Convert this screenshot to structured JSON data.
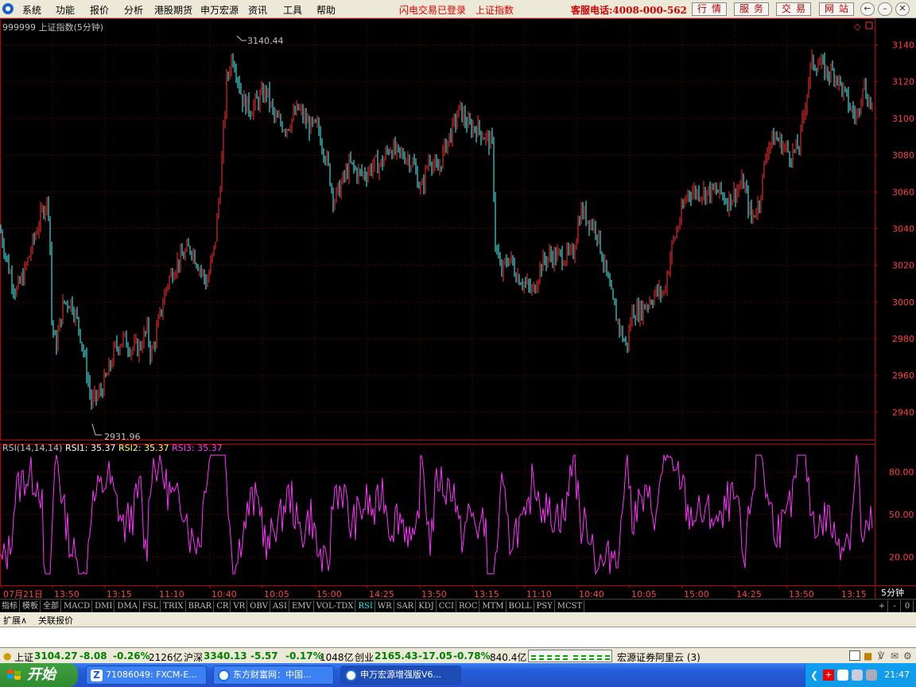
{
  "menu": {
    "items": [
      "系统",
      "功能",
      "报价",
      "分析",
      "港股期货",
      "申万宏源",
      "资讯",
      "工具",
      "帮助"
    ],
    "status_login": "闪电交易已登录",
    "index_name": "上证指数",
    "hotline": "客服电话:4008-000-562",
    "buttons": [
      "行情",
      "服务",
      "交易",
      "网站"
    ]
  },
  "chart": {
    "header": "999999 上证指数(5分钟)",
    "max_label": "3140.44",
    "min_label": "2931.96",
    "price_ticks": [
      "3140",
      "3120",
      "3100",
      "3080",
      "3060",
      "3040",
      "3020",
      "3000",
      "2980",
      "2960",
      "2940"
    ],
    "rsi_header": {
      "name": "RSI(14,14,14)",
      "rsi1": "RSI1: 35.37",
      "rsi2": "RSI2: 35.37",
      "rsi3": "RSI3: 35.37"
    },
    "rsi_ticks": [
      "80.00",
      "50.00",
      "20.00"
    ],
    "time_labels": [
      "07月21日",
      "13:50",
      "13:15",
      "11:10",
      "10:40",
      "10:05",
      "15:00",
      "14:25",
      "13:50",
      "13:15",
      "11:10",
      "10:40",
      "10:05",
      "15:00",
      "14:25",
      "13:50",
      "13:15"
    ],
    "period": "5分钟"
  },
  "chart_data": {
    "type": "candlestick",
    "title": "999999 上证指数(5分钟)",
    "ylim": [
      2925,
      3145
    ],
    "max": 3140.44,
    "min": 2931.96,
    "rsi": {
      "rsi1": 35.37,
      "rsi2": 35.37,
      "rsi3": 35.37,
      "ylim": [
        0,
        100
      ]
    },
    "close_path": [
      [
        0,
        3040
      ],
      [
        10,
        3020
      ],
      [
        20,
        3005
      ],
      [
        30,
        3015
      ],
      [
        40,
        3030
      ],
      [
        50,
        3045
      ],
      [
        58,
        3055
      ],
      [
        62,
        3050
      ],
      [
        65,
        2990
      ],
      [
        70,
        2975
      ],
      [
        80,
        3000
      ],
      [
        90,
        3000
      ],
      [
        100,
        2985
      ],
      [
        108,
        2965
      ],
      [
        115,
        2945
      ],
      [
        125,
        2950
      ],
      [
        135,
        2960
      ],
      [
        145,
        2975
      ],
      [
        155,
        2980
      ],
      [
        165,
        2975
      ],
      [
        175,
        2975
      ],
      [
        185,
        2985
      ],
      [
        190,
        2970
      ],
      [
        200,
        2990
      ],
      [
        210,
        3010
      ],
      [
        220,
        3020
      ],
      [
        230,
        3025
      ],
      [
        240,
        3030
      ],
      [
        250,
        3020
      ],
      [
        260,
        3010
      ],
      [
        270,
        3030
      ],
      [
        278,
        3070
      ],
      [
        285,
        3120
      ],
      [
        292,
        3135
      ],
      [
        298,
        3125
      ],
      [
        305,
        3110
      ],
      [
        315,
        3105
      ],
      [
        325,
        3110
      ],
      [
        335,
        3115
      ],
      [
        345,
        3100
      ],
      [
        360,
        3095
      ],
      [
        375,
        3105
      ],
      [
        390,
        3095
      ],
      [
        400,
        3095
      ],
      [
        412,
        3075
      ],
      [
        420,
        3055
      ],
      [
        430,
        3065
      ],
      [
        440,
        3075
      ],
      [
        450,
        3070
      ],
      [
        460,
        3070
      ],
      [
        470,
        3075
      ],
      [
        480,
        3075
      ],
      [
        490,
        3085
      ],
      [
        500,
        3080
      ],
      [
        510,
        3080
      ],
      [
        520,
        3075
      ],
      [
        530,
        3060
      ],
      [
        540,
        3080
      ],
      [
        550,
        3070
      ],
      [
        560,
        3085
      ],
      [
        570,
        3095
      ],
      [
        578,
        3105
      ],
      [
        590,
        3095
      ],
      [
        600,
        3095
      ],
      [
        610,
        3090
      ],
      [
        620,
        3085
      ],
      [
        622,
        3035
      ],
      [
        630,
        3015
      ],
      [
        640,
        3025
      ],
      [
        650,
        3015
      ],
      [
        660,
        3010
      ],
      [
        670,
        3005
      ],
      [
        680,
        3020
      ],
      [
        690,
        3025
      ],
      [
        700,
        3025
      ],
      [
        710,
        3025
      ],
      [
        720,
        3025
      ],
      [
        730,
        3050
      ],
      [
        740,
        3045
      ],
      [
        750,
        3040
      ],
      [
        760,
        3020
      ],
      [
        770,
        3000
      ],
      [
        780,
        2985
      ],
      [
        788,
        2975
      ],
      [
        795,
        2995
      ],
      [
        805,
        2995
      ],
      [
        815,
        3000
      ],
      [
        825,
        3005
      ],
      [
        835,
        3005
      ],
      [
        845,
        3030
      ],
      [
        855,
        3045
      ],
      [
        865,
        3060
      ],
      [
        875,
        3060
      ],
      [
        885,
        3060
      ],
      [
        895,
        3060
      ],
      [
        905,
        3060
      ],
      [
        915,
        3055
      ],
      [
        925,
        3060
      ],
      [
        935,
        3065
      ],
      [
        945,
        3045
      ],
      [
        955,
        3055
      ],
      [
        965,
        3085
      ],
      [
        975,
        3090
      ],
      [
        985,
        3085
      ],
      [
        995,
        3080
      ],
      [
        1005,
        3085
      ],
      [
        1015,
        3115
      ],
      [
        1020,
        3130
      ],
      [
        1030,
        3130
      ],
      [
        1040,
        3125
      ],
      [
        1050,
        3125
      ],
      [
        1060,
        3115
      ],
      [
        1070,
        3105
      ],
      [
        1078,
        3100
      ],
      [
        1085,
        3120
      ],
      [
        1092,
        3110
      ],
      [
        1100,
        3105
      ]
    ]
  },
  "tabs": [
    "指标",
    "模板",
    "全部",
    "MACD",
    "DMI",
    "DMA",
    "FSL",
    "TRIX",
    "BRAR",
    "CR",
    "VR",
    "OBV",
    "ASI",
    "EMV",
    "VOL-TDX",
    "RSI",
    "WR",
    "SAR",
    "KDJ",
    "CCI",
    "ROC",
    "MTM",
    "BOLL",
    "PSY",
    "MCST"
  ],
  "tab_active": "RSI",
  "tab_controls": [
    "+",
    "-",
    "0"
  ],
  "subtabs": [
    "扩展∧",
    "关联报价"
  ],
  "status": {
    "sh_label": "上证",
    "sh_value": "3104.27",
    "sh_change": "-8.08",
    "sh_pct": "-0.26%",
    "sh_amount": "2126亿",
    "hs_label": "沪深",
    "hs_value": "3340.13",
    "hs_change": "-5.57",
    "hs_pct": "-0.17%",
    "hs_amount": "1048亿",
    "cy_label": "创业",
    "cy_value": "2165.43",
    "cy_change": "-17.05",
    "cy_pct": "-0.78%",
    "cy_amount": "840.4亿",
    "server": "宏源证券阿里云 (3)"
  },
  "taskbar": {
    "start": "开始",
    "tasks": [
      "71086049: FXCM-E...",
      "东方财富网：中国...",
      "申万宏源增强版V6..."
    ],
    "clock": "21:47"
  },
  "colors": {
    "up": "#ff3232",
    "down": "#54ffff",
    "rsi": "#ff33ff",
    "grid": "#8b0000",
    "axis": "#c00000"
  }
}
